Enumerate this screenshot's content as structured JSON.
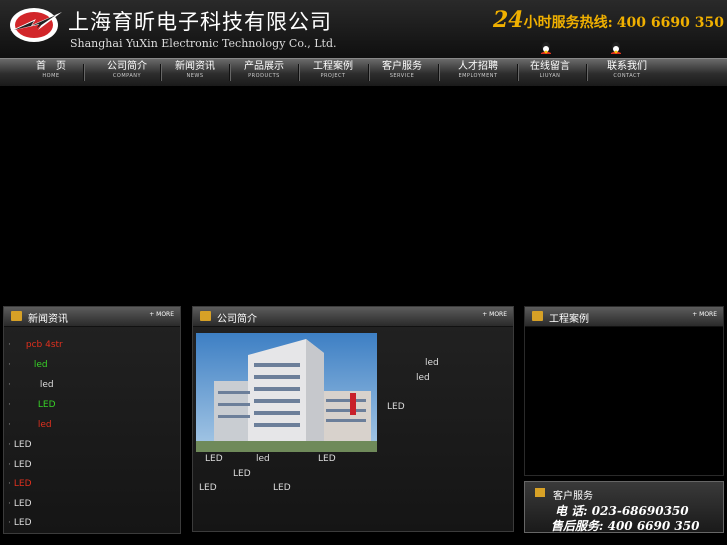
{
  "header": {
    "company_cn": "上海育昕电子科技有限公司",
    "company_en": "Shanghai YuXin Electronic Technology Co., Ltd.",
    "hotline_24": "24",
    "hotline_label": "小时服务热线:",
    "hotline_phone": "400 6690 350"
  },
  "nav": [
    {
      "cn": "首　页",
      "en": "HOME"
    },
    {
      "cn": "公司简介",
      "en": "COMPANY"
    },
    {
      "cn": "新闻资讯",
      "en": "NEWS"
    },
    {
      "cn": "产品展示",
      "en": "PRODUCTS"
    },
    {
      "cn": "工程案例",
      "en": "PROJECT"
    },
    {
      "cn": "客户服务",
      "en": "SERVICE"
    },
    {
      "cn": "人才招聘",
      "en": "EMPLOYMENT"
    },
    {
      "cn": "在线留言",
      "en": "LIUYAN"
    },
    {
      "cn": "联系我们",
      "en": "CONTACT"
    }
  ],
  "more_label": "+ MORE",
  "news": {
    "title": "新闻资讯",
    "items": [
      {
        "text": "pcb 4str",
        "color": "#e0301e"
      },
      {
        "text": "led",
        "color": "#37d027"
      },
      {
        "text": "led",
        "color": "#dddddd"
      },
      {
        "text": "LED",
        "color": "#37d027"
      },
      {
        "text": "led",
        "color": "#e0301e"
      },
      {
        "text": "LED",
        "color": "#dddddd"
      },
      {
        "text": "LED",
        "color": "#dddddd"
      },
      {
        "text": "LED",
        "color": "#e0301e"
      },
      {
        "text": "LED",
        "color": "#dddddd"
      },
      {
        "text": "LED",
        "color": "#dddddd"
      }
    ]
  },
  "about": {
    "title": "公司简介",
    "snippets": [
      "led",
      "led",
      "LED",
      "LED",
      "led",
      "LED",
      "LED",
      "LED",
      "LED"
    ]
  },
  "projects": {
    "title": "工程案例"
  },
  "service": {
    "title": "客户服务",
    "tel": "电 话: 023-68690350",
    "after": "售后服务: 400 6690 350"
  }
}
